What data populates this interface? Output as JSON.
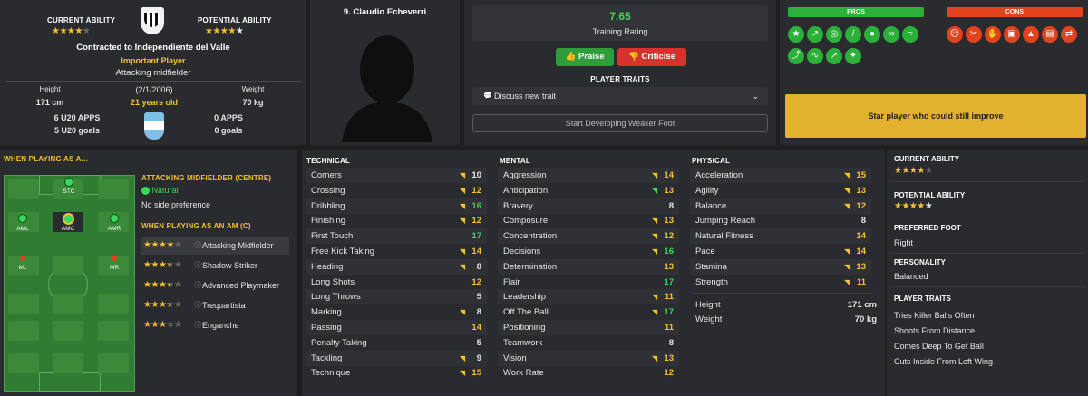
{
  "header": {
    "current_ability_label": "CURRENT ABILITY",
    "potential_ability_label": "POTENTIAL ABILITY",
    "current_stars": 4,
    "potential_stars": 4.5,
    "contract": "Contracted to Independiente del Valle",
    "status": "Important Player",
    "position": "Attacking midfielder",
    "height_label": "Height",
    "height": "171 cm",
    "dob": "(2/1/2006)",
    "age": "21 years old",
    "weight_label": "Weight",
    "weight": "70 kg",
    "intl_apps": "6 U20 APPS",
    "intl_goals": "5 U20 goals",
    "club_apps": "0 APPS",
    "club_goals": "0 goals"
  },
  "portrait": {
    "name": "9. Claudio Echeverri"
  },
  "training": {
    "rating": "7.65",
    "rating_label": "Training Rating",
    "praise_label": "Praise",
    "criticise_label": "Criticise",
    "traits_label": "PLAYER TRAITS",
    "discuss_label": "Discuss new trait",
    "weak_foot_label": "Start Developing Weaker Foot"
  },
  "pros_cons": {
    "pros_label": "PROS",
    "cons_label": "CONS",
    "pros_icons": [
      "star-icon",
      "running-icon",
      "target-icon",
      "bandage-icon",
      "boot-icon",
      "bicycle-icon",
      "agility-icon",
      "kick-icon",
      "graph-icon",
      "trend-up-icon",
      "brain-icon"
    ],
    "cons_icons": [
      "angry-icon",
      "scissors-icon",
      "hand-icon",
      "lock-icon",
      "cone-icon",
      "clipboard-icon",
      "arrows-icon"
    ],
    "summary": "Star player who could still improve"
  },
  "playing_as": {
    "title": "WHEN PLAYING AS A...",
    "role_title": "ATTACKING MIDFIELDER (CENTRE)",
    "natural_label": "Natural",
    "foot_note": "No side preference",
    "as_am_title": "WHEN PLAYING AS AN AM (C)",
    "pitch_labels": {
      "stc": "STC",
      "aml": "AML",
      "amc": "AMC",
      "amr": "AMR",
      "ml": "ML",
      "mr": "MR"
    },
    "roles": [
      {
        "name": "Attacking Midfielder",
        "stars": 4
      },
      {
        "name": "Shadow Striker",
        "stars": 3.5
      },
      {
        "name": "Advanced Playmaker",
        "stars": 3.5
      },
      {
        "name": "Trequartista",
        "stars": 3.5
      },
      {
        "name": "Enganche",
        "stars": 3
      }
    ]
  },
  "technical": {
    "title": "TECHNICAL",
    "rows": [
      {
        "name": "Corners",
        "value": "10",
        "arrow": "up"
      },
      {
        "name": "Crossing",
        "value": "12",
        "arrow": "up"
      },
      {
        "name": "Dribbling",
        "value": "16",
        "arrow": "up"
      },
      {
        "name": "Finishing",
        "value": "12",
        "arrow": "up"
      },
      {
        "name": "First Touch",
        "value": "17",
        "arrow": ""
      },
      {
        "name": "Free Kick Taking",
        "value": "14",
        "arrow": "up"
      },
      {
        "name": "Heading",
        "value": "8",
        "arrow": "up"
      },
      {
        "name": "Long Shots",
        "value": "12",
        "arrow": ""
      },
      {
        "name": "Long Throws",
        "value": "5",
        "arrow": ""
      },
      {
        "name": "Marking",
        "value": "8",
        "arrow": "up"
      },
      {
        "name": "Passing",
        "value": "14",
        "arrow": ""
      },
      {
        "name": "Penalty Taking",
        "value": "5",
        "arrow": ""
      },
      {
        "name": "Tackling",
        "value": "9",
        "arrow": "up"
      },
      {
        "name": "Technique",
        "value": "15",
        "arrow": "up"
      }
    ]
  },
  "mental": {
    "title": "MENTAL",
    "rows": [
      {
        "name": "Aggression",
        "value": "14",
        "arrow": "up"
      },
      {
        "name": "Anticipation",
        "value": "13",
        "arrow": "up-green"
      },
      {
        "name": "Bravery",
        "value": "8",
        "arrow": ""
      },
      {
        "name": "Composure",
        "value": "13",
        "arrow": "up"
      },
      {
        "name": "Concentration",
        "value": "12",
        "arrow": "up"
      },
      {
        "name": "Decisions",
        "value": "16",
        "arrow": "up"
      },
      {
        "name": "Determination",
        "value": "13",
        "arrow": ""
      },
      {
        "name": "Flair",
        "value": "17",
        "arrow": ""
      },
      {
        "name": "Leadership",
        "value": "11",
        "arrow": "up"
      },
      {
        "name": "Off The Ball",
        "value": "17",
        "arrow": "up"
      },
      {
        "name": "Positioning",
        "value": "11",
        "arrow": ""
      },
      {
        "name": "Teamwork",
        "value": "8",
        "arrow": ""
      },
      {
        "name": "Vision",
        "value": "13",
        "arrow": "up"
      },
      {
        "name": "Work Rate",
        "value": "12",
        "arrow": ""
      }
    ]
  },
  "physical": {
    "title": "PHYSICAL",
    "rows": [
      {
        "name": "Acceleration",
        "value": "15",
        "arrow": "up"
      },
      {
        "name": "Agility",
        "value": "13",
        "arrow": "up"
      },
      {
        "name": "Balance",
        "value": "12",
        "arrow": "up"
      },
      {
        "name": "Jumping Reach",
        "value": "8",
        "arrow": ""
      },
      {
        "name": "Natural Fitness",
        "value": "14",
        "arrow": ""
      },
      {
        "name": "Pace",
        "value": "14",
        "arrow": "up"
      },
      {
        "name": "Stamina",
        "value": "13",
        "arrow": "up"
      },
      {
        "name": "Strength",
        "value": "11",
        "arrow": "up"
      }
    ],
    "height_label": "Height",
    "height": "171 cm",
    "weight_label": "Weight",
    "weight": "70 kg"
  },
  "right_panel": {
    "current_label": "CURRENT ABILITY",
    "current_stars": 4,
    "potential_label": "POTENTIAL ABILITY",
    "potential_stars": 4.5,
    "foot_label": "PREFERRED FOOT",
    "foot": "Right",
    "personality_label": "PERSONALITY",
    "personality": "Balanced",
    "traits_label": "PLAYER TRAITS",
    "traits": [
      "Tries Killer Balls Often",
      "Shoots From Distance",
      "Comes Deep To Get Ball",
      "Cuts Inside From Left Wing"
    ]
  },
  "colors": {
    "accent": "#f2c230",
    "green": "#3ad85b",
    "pro": "#2bb03a",
    "con": "#e0431e",
    "praise": "#2e9d3a",
    "criticise": "#d8322f"
  }
}
